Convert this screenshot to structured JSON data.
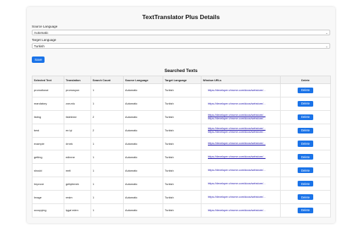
{
  "page": {
    "title": "TextTranslator Plus Details"
  },
  "form": {
    "source_label": "Source Language",
    "source_value": "Automatic",
    "target_label": "Target Language",
    "target_value": "Turkish",
    "save_label": "Save"
  },
  "searched": {
    "title": "Searched Texts",
    "headers": [
      "Selected Text",
      "Translation",
      "Search Count",
      "Source Language",
      "Target Language",
      "Window URLs",
      "Delete"
    ],
    "delete_label": "Delete",
    "url_text": "https://developer.chrome.com/docs/webstore/...",
    "rows": [
      {
        "text": "promotional",
        "translation": "promosyon",
        "count": "1",
        "source": "Automatic",
        "target": "Turkish",
        "url_count": 1
      },
      {
        "text": "mandatory",
        "translation": "zorunlu",
        "count": "1",
        "source": "Automatic",
        "target": "Turkish",
        "url_count": 1
      },
      {
        "text": "listing",
        "translation": "listeleme",
        "count": "2",
        "source": "Automatic",
        "target": "Turkish",
        "url_count": 2
      },
      {
        "text": "best",
        "translation": "en iyi",
        "count": "2",
        "source": "Automatic",
        "target": "Turkish",
        "url_count": 2
      },
      {
        "text": "example",
        "translation": "örnek",
        "count": "1",
        "source": "Automatic",
        "target": "Turkish",
        "url_count": 1
      },
      {
        "text": "getting",
        "translation": "edinme",
        "count": "1",
        "source": "Automatic",
        "target": "Turkish",
        "url_count": 1
      },
      {
        "text": "should",
        "translation": "meli",
        "count": "1",
        "source": "Automatic",
        "target": "Turkish",
        "url_count": 1
      },
      {
        "text": "Improve",
        "translation": "geliştirmek",
        "count": "1",
        "source": "Automatic",
        "target": "Turkish",
        "url_count": 1
      },
      {
        "text": "Image",
        "translation": "resim",
        "count": "1",
        "source": "Automatic",
        "target": "Turkish",
        "url_count": 1
      },
      {
        "text": "occupying",
        "translation": "işgal eden",
        "count": "1",
        "source": "Automatic",
        "target": "Turkish",
        "url_count": 1
      }
    ]
  },
  "colors": {
    "accent": "#1a73e8",
    "link": "#1a0dab"
  }
}
